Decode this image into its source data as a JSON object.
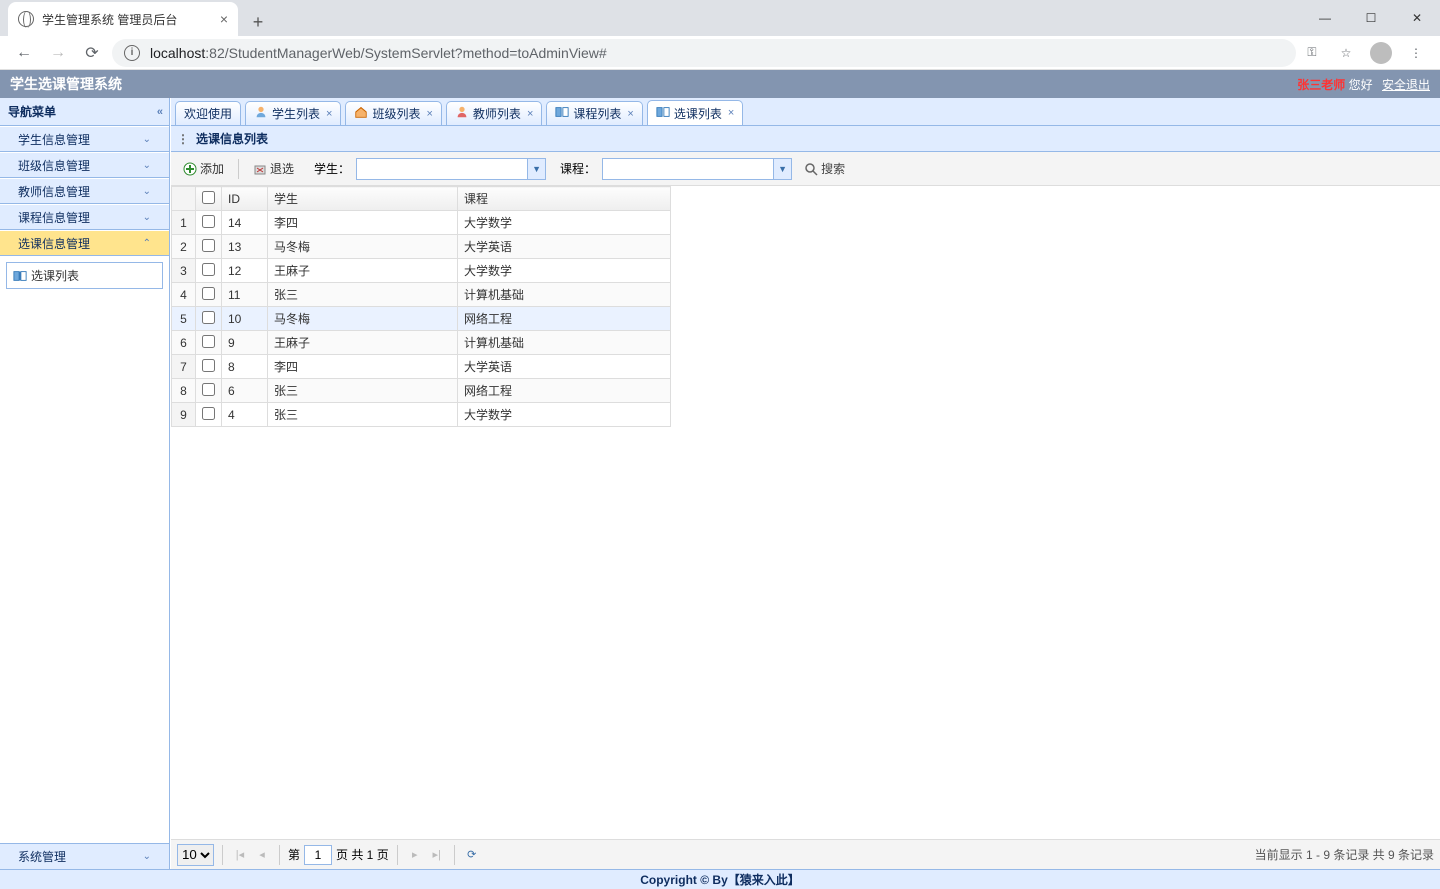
{
  "browser": {
    "tab_title": "学生管理系统 管理员后台",
    "url_host": "localhost",
    "url_port": ":82",
    "url_path": "/StudentManagerWeb/SystemServlet?method=toAdminView#"
  },
  "header": {
    "app_title": "学生选课管理系统",
    "user_name": "张三老师",
    "greeting": "您好",
    "logout": "安全退出"
  },
  "sidebar": {
    "title": "导航菜单",
    "items": [
      {
        "label": "学生信息管理"
      },
      {
        "label": "班级信息管理"
      },
      {
        "label": "教师信息管理"
      },
      {
        "label": "课程信息管理"
      },
      {
        "label": "选课信息管理"
      }
    ],
    "sublink": "选课列表",
    "bottom": "系统管理"
  },
  "tabs": [
    {
      "label": "欢迎使用",
      "icon": "",
      "closable": false
    },
    {
      "label": "学生列表",
      "icon": "user",
      "closable": true
    },
    {
      "label": "班级列表",
      "icon": "home",
      "closable": true
    },
    {
      "label": "教师列表",
      "icon": "teacher",
      "closable": true
    },
    {
      "label": "课程列表",
      "icon": "book",
      "closable": true
    },
    {
      "label": "选课列表",
      "icon": "book",
      "closable": true
    }
  ],
  "activeTab": 5,
  "panel": {
    "title": "选课信息列表",
    "add_label": "添加",
    "remove_label": "退选",
    "student_label": "学生：",
    "course_label": "课程：",
    "search_label": "搜索"
  },
  "columns": {
    "id": "ID",
    "student": "学生",
    "course": "课程"
  },
  "rows": [
    {
      "id": "14",
      "student": "李四",
      "course": "大学数学"
    },
    {
      "id": "13",
      "student": "马冬梅",
      "course": "大学英语"
    },
    {
      "id": "12",
      "student": "王麻子",
      "course": "大学数学"
    },
    {
      "id": "11",
      "student": "张三",
      "course": "计算机基础"
    },
    {
      "id": "10",
      "student": "马冬梅",
      "course": "网络工程"
    },
    {
      "id": "9",
      "student": "王麻子",
      "course": "计算机基础"
    },
    {
      "id": "8",
      "student": "李四",
      "course": "大学英语"
    },
    {
      "id": "6",
      "student": "张三",
      "course": "网络工程"
    },
    {
      "id": "4",
      "student": "张三",
      "course": "大学数学"
    }
  ],
  "hoverRow": 4,
  "pager": {
    "page_size": "10",
    "prefix": "第",
    "page": "1",
    "suffix": "页 共 1 页",
    "info": "当前显示 1 - 9 条记录 共 9 条记录"
  },
  "footer": {
    "copy_left": "Copyright © By ",
    "copy_link": "【猿来入此】"
  }
}
